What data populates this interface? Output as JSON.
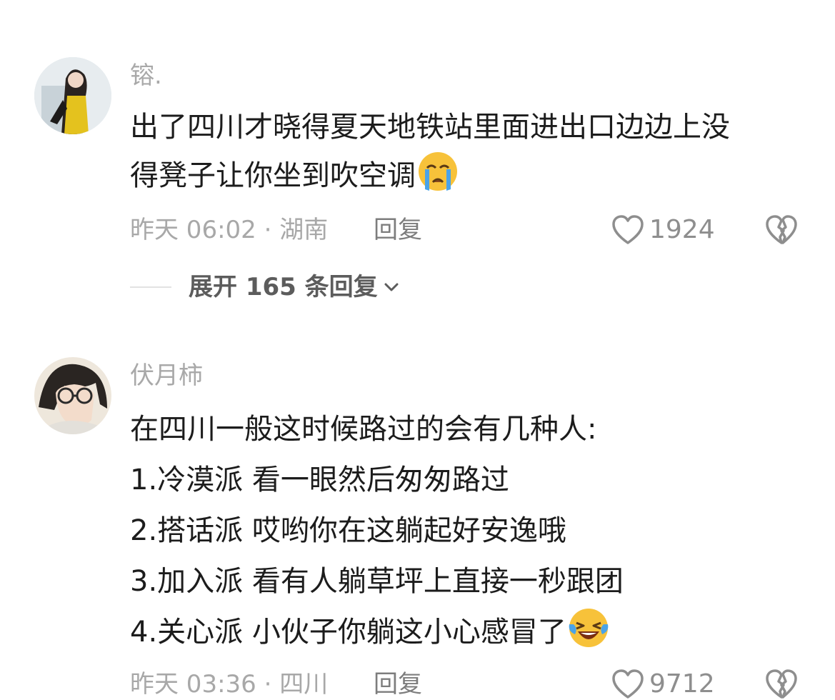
{
  "comments": [
    {
      "username": "镕.",
      "lines": [
        "出了四川才晓得夏天地铁站里面进出口边边上没",
        "得凳子让你坐到吹空调"
      ],
      "emoji": "crying-face",
      "time_location": "昨天 06:02 · 湖南",
      "reply_label": "回复",
      "likes": "1924",
      "expand_label": "展开 165 条回复"
    },
    {
      "username": "伏月柿",
      "lines": [
        "在四川一般这时候路过的会有几种人:",
        "1.冷漠派 看一眼然后匆匆路过",
        "2.搭话派 哎哟你在这躺起好安逸哦",
        "3.加入派 看有人躺草坪上直接一秒跟团",
        "4.关心派 小伙子你躺这小心感冒了"
      ],
      "emoji": "laughing-tears-face",
      "time_location": "昨天 03:36 · 四川",
      "reply_label": "回复",
      "likes": "9712"
    }
  ],
  "colors": {
    "username": "#a9a9a9",
    "text": "#1c1c1c",
    "meta": "#a8a8a8",
    "icon": "#8e8e8e",
    "emoji_face": "#f7c23a"
  }
}
